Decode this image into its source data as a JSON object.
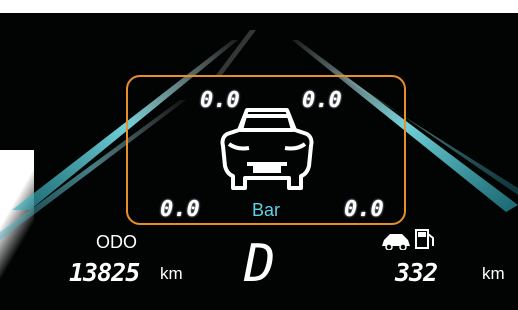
{
  "tire_pressure": {
    "front_left": "0.0",
    "front_right": "0.0",
    "rear_left": "0.0",
    "rear_right": "0.0",
    "unit": "Bar"
  },
  "odometer": {
    "label": "ODO",
    "value": "13825",
    "unit": "km"
  },
  "gear": "D",
  "range": {
    "value": "332",
    "unit": "km",
    "icon": "car-fuel-icon"
  },
  "colors": {
    "highlight": "#e88e2a",
    "accent": "#5fd0e6",
    "background": "#020303"
  }
}
